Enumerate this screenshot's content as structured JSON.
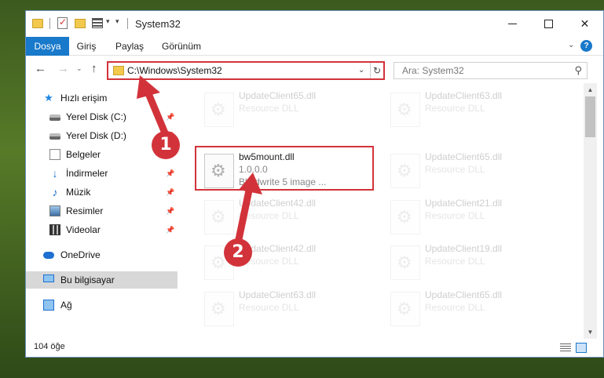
{
  "window": {
    "title": "System32"
  },
  "ribbon": {
    "tabs": [
      "Dosya",
      "Giriş",
      "Paylaş",
      "Görünüm"
    ],
    "help_label": "?"
  },
  "navbar": {
    "address": "C:\\Windows\\System32",
    "search_placeholder": "Ara: System32"
  },
  "sidebar": {
    "items": [
      {
        "label": "Hızlı erişim",
        "icon": "star-icon"
      },
      {
        "label": "Yerel Disk (C:)",
        "icon": "drive-icon",
        "pinned": true
      },
      {
        "label": "Yerel Disk (D:)",
        "icon": "drive-icon",
        "pinned": true
      },
      {
        "label": "Belgeler",
        "icon": "documents-icon",
        "pinned": true
      },
      {
        "label": "İndirmeler",
        "icon": "downloads-icon",
        "pinned": true
      },
      {
        "label": "Müzik",
        "icon": "music-icon",
        "pinned": true
      },
      {
        "label": "Resimler",
        "icon": "pictures-icon",
        "pinned": true
      },
      {
        "label": "Videolar",
        "icon": "videos-icon",
        "pinned": true
      },
      {
        "label": "OneDrive",
        "icon": "onedrive-icon"
      },
      {
        "label": "Bu bilgisayar",
        "icon": "this-pc-icon",
        "selected": true
      },
      {
        "label": "Ağ",
        "icon": "network-icon"
      }
    ]
  },
  "files": {
    "left": [
      {
        "name": "UpdateClient65.dll",
        "desc": "Resource DLL",
        "faded": true
      },
      {
        "name": "bw5mount.dll",
        "desc": "1.0.0.0",
        "desc2": "Blindwrite 5 image ...",
        "faded": false
      },
      {
        "name": "UpdateClient42.dll",
        "desc": "Resource DLL",
        "faded": true
      },
      {
        "name": "UpdateClient42.dll",
        "desc": "Resource DLL",
        "faded": true
      },
      {
        "name": "UpdateClient63.dll",
        "desc": "Resource DLL",
        "faded": true
      }
    ],
    "right": [
      {
        "name": "UpdateClient63.dll",
        "desc": "Resource DLL"
      },
      {
        "name": "UpdateClient65.dll",
        "desc": "Resource DLL"
      },
      {
        "name": "UpdateClient21.dll",
        "desc": "Resource DLL"
      },
      {
        "name": "UpdateClient19.dll",
        "desc": "Resource DLL"
      },
      {
        "name": "UpdateClient65.dll",
        "desc": "Resource DLL"
      }
    ]
  },
  "status": {
    "item_count": "104 öğe"
  },
  "callouts": [
    "1",
    "2"
  ],
  "colors": {
    "accent": "#1979ca",
    "highlight": "#d2333a"
  }
}
